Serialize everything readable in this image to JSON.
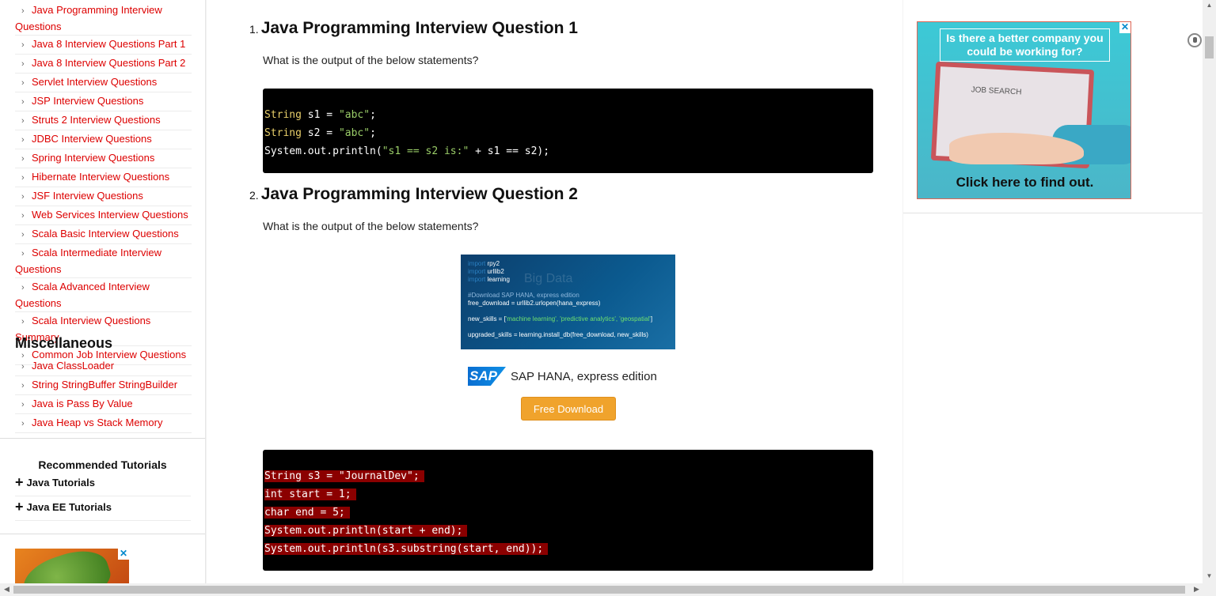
{
  "sidebar": {
    "top_items": [
      "Java Programming Interview Questions",
      "Java 8 Interview Questions Part 1",
      "Java 8 Interview Questions Part 2",
      "Servlet Interview Questions",
      "JSP Interview Questions",
      "Struts 2 Interview Questions",
      "JDBC Interview Questions",
      "Spring Interview Questions",
      "Hibernate Interview Questions",
      "JSF Interview Questions",
      "Web Services Interview Questions",
      "Scala Basic Interview Questions",
      "Scala Intermediate Interview Questions",
      "Scala Advanced Interview Questions",
      "Scala Interview Questions Summary",
      "Common Job Interview Questions"
    ],
    "misc_title": "Miscellaneous",
    "misc_items": [
      "Java ClassLoader",
      "String StringBuffer StringBuilder",
      "Java is Pass By Value",
      "Java Heap vs Stack Memory"
    ],
    "recommended_title": "Recommended Tutorials",
    "recommended_items": [
      "Java Tutorials",
      "Java EE Tutorials"
    ],
    "chevron": "›",
    "plus": "+",
    "ad_close": "✕"
  },
  "main": {
    "q1": {
      "number": "1.",
      "title": "Java Programming Interview Question 1",
      "text": "What is the output of the below statements?"
    },
    "q2": {
      "number": "2.",
      "title": "Java Programming Interview Question 2",
      "text": "What is the output of the below statements?"
    },
    "code1": {
      "l1_type": "String",
      "l1_rest": " s1 = ",
      "l1_str": "\"abc\"",
      "l1_end": ";",
      "l2_type": "String",
      "l2_rest": " s2 = ",
      "l2_str": "\"abc\"",
      "l2_end": ";",
      "l3_a": "System.out.println(",
      "l3_str": "\"s1 == s2 is:\"",
      "l3_b": " + s1 == s2);"
    },
    "code2": [
      "String s3 = \"JournalDev\";",
      "int start = 1;",
      "char end = 5;",
      "System.out.println(start + end);",
      "System.out.println(s3.substring(start, end));"
    ],
    "sap_ad": {
      "code_lines": {
        "imp1_kw": "import",
        "imp1": " rpy2",
        "imp2_kw": "import",
        "imp2": " urllib2",
        "imp3_kw": "import",
        "imp3": " learning",
        "comment": "#Download SAP HANA, express edition",
        "download": "free_download = urllib2.urlopen(hana_express)",
        "skills_a": "new_skills = [",
        "skills_b": "'machine learning', 'predictive analytics', 'geospatial'",
        "skills_c": "]",
        "upgraded": "upgraded_skills = learning.install_db(free_download, new_skills)"
      },
      "bg_text": "Big Data",
      "logo": "SAP",
      "product": "SAP HANA, express edition",
      "button": "Free Download"
    }
  },
  "right_ad": {
    "headline": "Is there a better company you could be working for?",
    "screen_text": "JOB SEARCH",
    "cta": "Click here to find out.",
    "close": "✕"
  },
  "scroll": {
    "up": "▲",
    "down": "▼",
    "left": "◀",
    "right": "▶"
  }
}
